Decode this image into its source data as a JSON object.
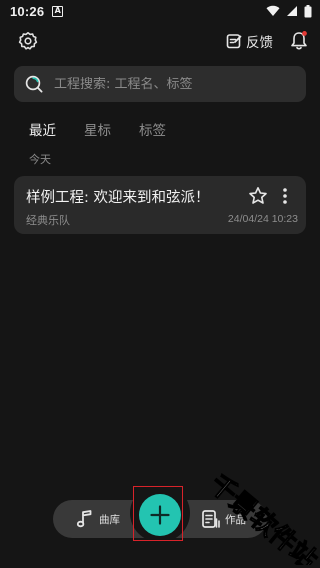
{
  "status_bar": {
    "time": "10:26",
    "notification_letter": "A"
  },
  "header": {
    "feedback_label": "反馈"
  },
  "search": {
    "placeholder": "工程搜索: 工程名、标签"
  },
  "tabs": [
    {
      "label": "最近",
      "active": true
    },
    {
      "label": "星标",
      "active": false
    },
    {
      "label": "标签",
      "active": false
    }
  ],
  "section": {
    "date_label": "今天"
  },
  "projects": [
    {
      "title": "样例工程: 欢迎来到和弦派！",
      "tag": "经典乐队",
      "date": "24/04/24 10:23"
    }
  ],
  "bottom_nav": {
    "library_label": "曲库",
    "works_label": "作品"
  },
  "watermark": {
    "text": "千景软件站"
  },
  "colors": {
    "background": "#151515",
    "card": "#2a2a2a",
    "accent": "#23c4b1",
    "highlight": "#d8232a"
  },
  "icons": [
    "settings-icon",
    "feedback-icon",
    "bell-icon",
    "search-icon",
    "star-icon",
    "more-icon",
    "music-note-icon",
    "plus-icon",
    "works-list-icon"
  ]
}
